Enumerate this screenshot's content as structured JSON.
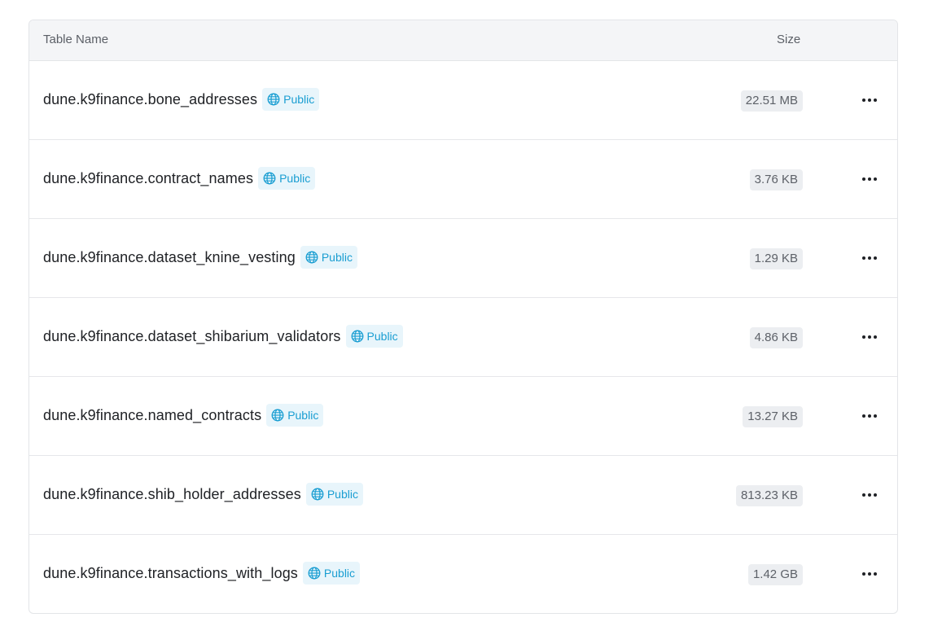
{
  "table": {
    "headers": {
      "name": "Table Name",
      "size": "Size"
    },
    "rows": [
      {
        "name": "dune.k9finance.bone_addresses",
        "badge": "Public",
        "size": "22.51 MB"
      },
      {
        "name": "dune.k9finance.contract_names",
        "badge": "Public",
        "size": "3.76 KB"
      },
      {
        "name": "dune.k9finance.dataset_knine_vesting",
        "badge": "Public",
        "size": "1.29 KB"
      },
      {
        "name": "dune.k9finance.dataset_shibarium_validators",
        "badge": "Public",
        "size": "4.86 KB"
      },
      {
        "name": "dune.k9finance.named_contracts",
        "badge": "Public",
        "size": "13.27 KB"
      },
      {
        "name": "dune.k9finance.shib_holder_addresses",
        "badge": "Public",
        "size": "813.23 KB"
      },
      {
        "name": "dune.k9finance.transactions_with_logs",
        "badge": "Public",
        "size": "1.42 GB"
      }
    ]
  },
  "icons": {
    "badge_icon": "globe-icon",
    "row_action_icon": "more-horizontal-icon"
  },
  "colors": {
    "badge_text": "#1a9ed2",
    "badge_bg": "#e8f5fb",
    "size_pill_bg": "#eceef1",
    "header_bg": "#f4f5f7"
  }
}
